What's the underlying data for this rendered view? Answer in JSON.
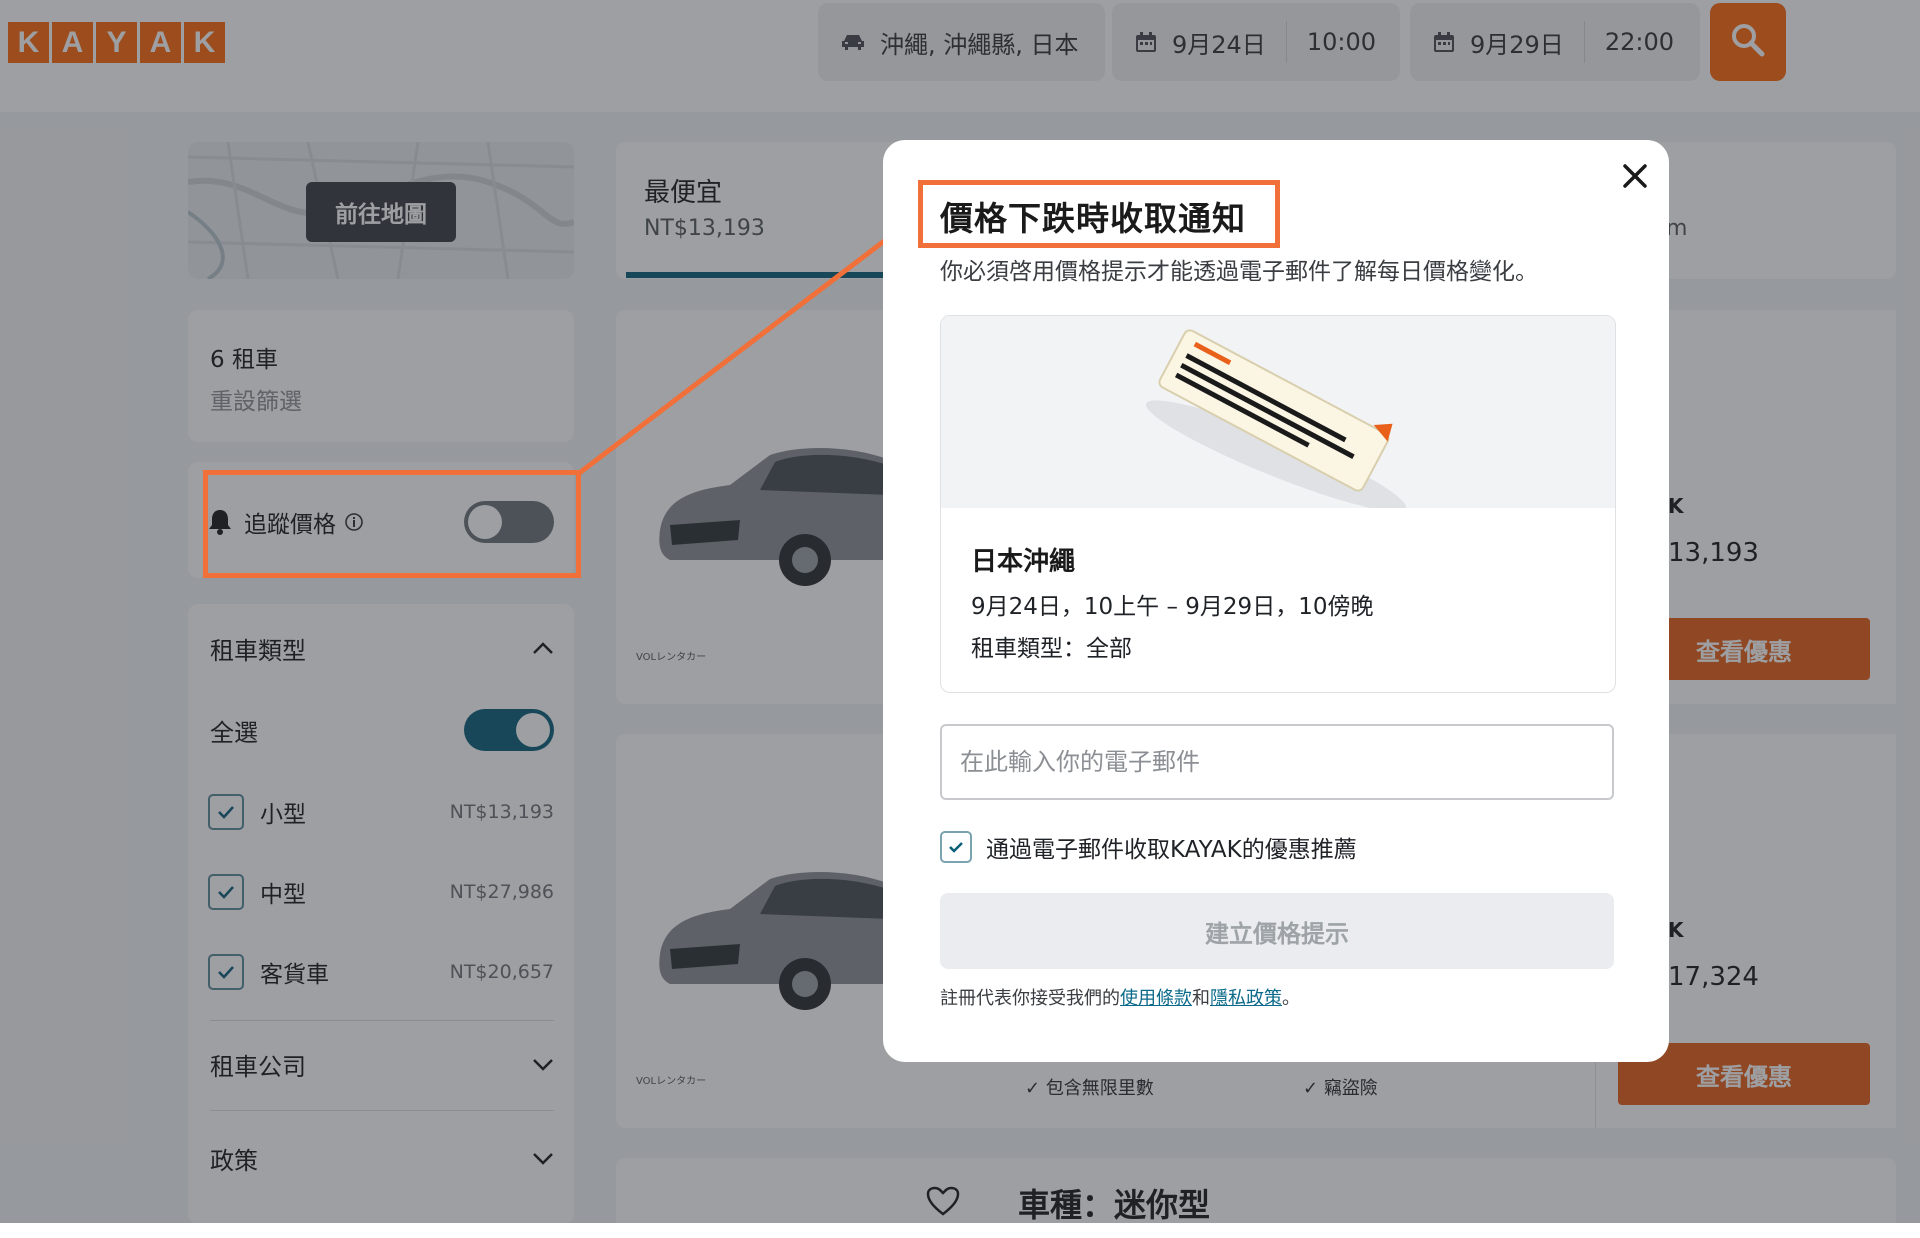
{
  "colors": {
    "brand": "#ff690f",
    "accent_teal": "#0b5f78",
    "deal_button": "#e8601a",
    "annotation": "#f1703a"
  },
  "header": {
    "logo_letters": [
      "K",
      "A",
      "Y",
      "A",
      "K"
    ],
    "location": "沖繩, 沖繩縣, 日本",
    "pickup_date": "9月24日",
    "pickup_time": "10:00",
    "dropoff_date": "9月29日",
    "dropoff_time": "22:00",
    "icons": {
      "location": "car-icon",
      "date": "calendar-icon",
      "search": "search-icon"
    }
  },
  "sidebar": {
    "map_button": "前往地圖",
    "results_count": "6 租車",
    "reset_filters": "重設篩選",
    "track_prices": "追蹤價格",
    "car_type_section": "租車類型",
    "select_all": "全選",
    "car_types": [
      {
        "label": "小型",
        "price": "NT$13,193"
      },
      {
        "label": "中型",
        "price": "NT$27,986"
      },
      {
        "label": "客貨車",
        "price": "NT$20,657"
      }
    ],
    "company_section": "租車公司",
    "policy_section": "政策"
  },
  "results": {
    "tab_cheapest_label": "最便宜",
    "tab_cheapest_price": "NT$13,193",
    "tab_right_fragment": "m",
    "card1_fragment_k": "K",
    "card1_price_fragment": "13,193",
    "card2_fragment_k": "K",
    "card2_price_fragment": "17,324",
    "deal_button": "查看優惠",
    "supplier_logo": "VOLレンタカー",
    "feature_unlimited": "包含無限里數",
    "feature_theft": "竊盜險",
    "next_card_title": "車種：迷你型"
  },
  "modal": {
    "title": "價格下跌時收取通知",
    "subtitle": "你必須啓用價格提示才能透過電子郵件了解每日價格變化。",
    "location": "日本沖繩",
    "dates": "9月24日，10上午 – 9月29日，10傍晚",
    "car_type": "租車類型：全部",
    "email_placeholder": "在此輸入你的電子郵件",
    "email_value": "",
    "opt_in_label": "通過電子郵件收取KAYAK的優惠推薦",
    "opt_in_checked": true,
    "create_button": "建立價格提示",
    "legal_prefix": "註冊代表你接受我們的",
    "legal_terms": "使用條款",
    "legal_and": "和",
    "legal_privacy": "隱私政策",
    "legal_suffix": "。"
  }
}
